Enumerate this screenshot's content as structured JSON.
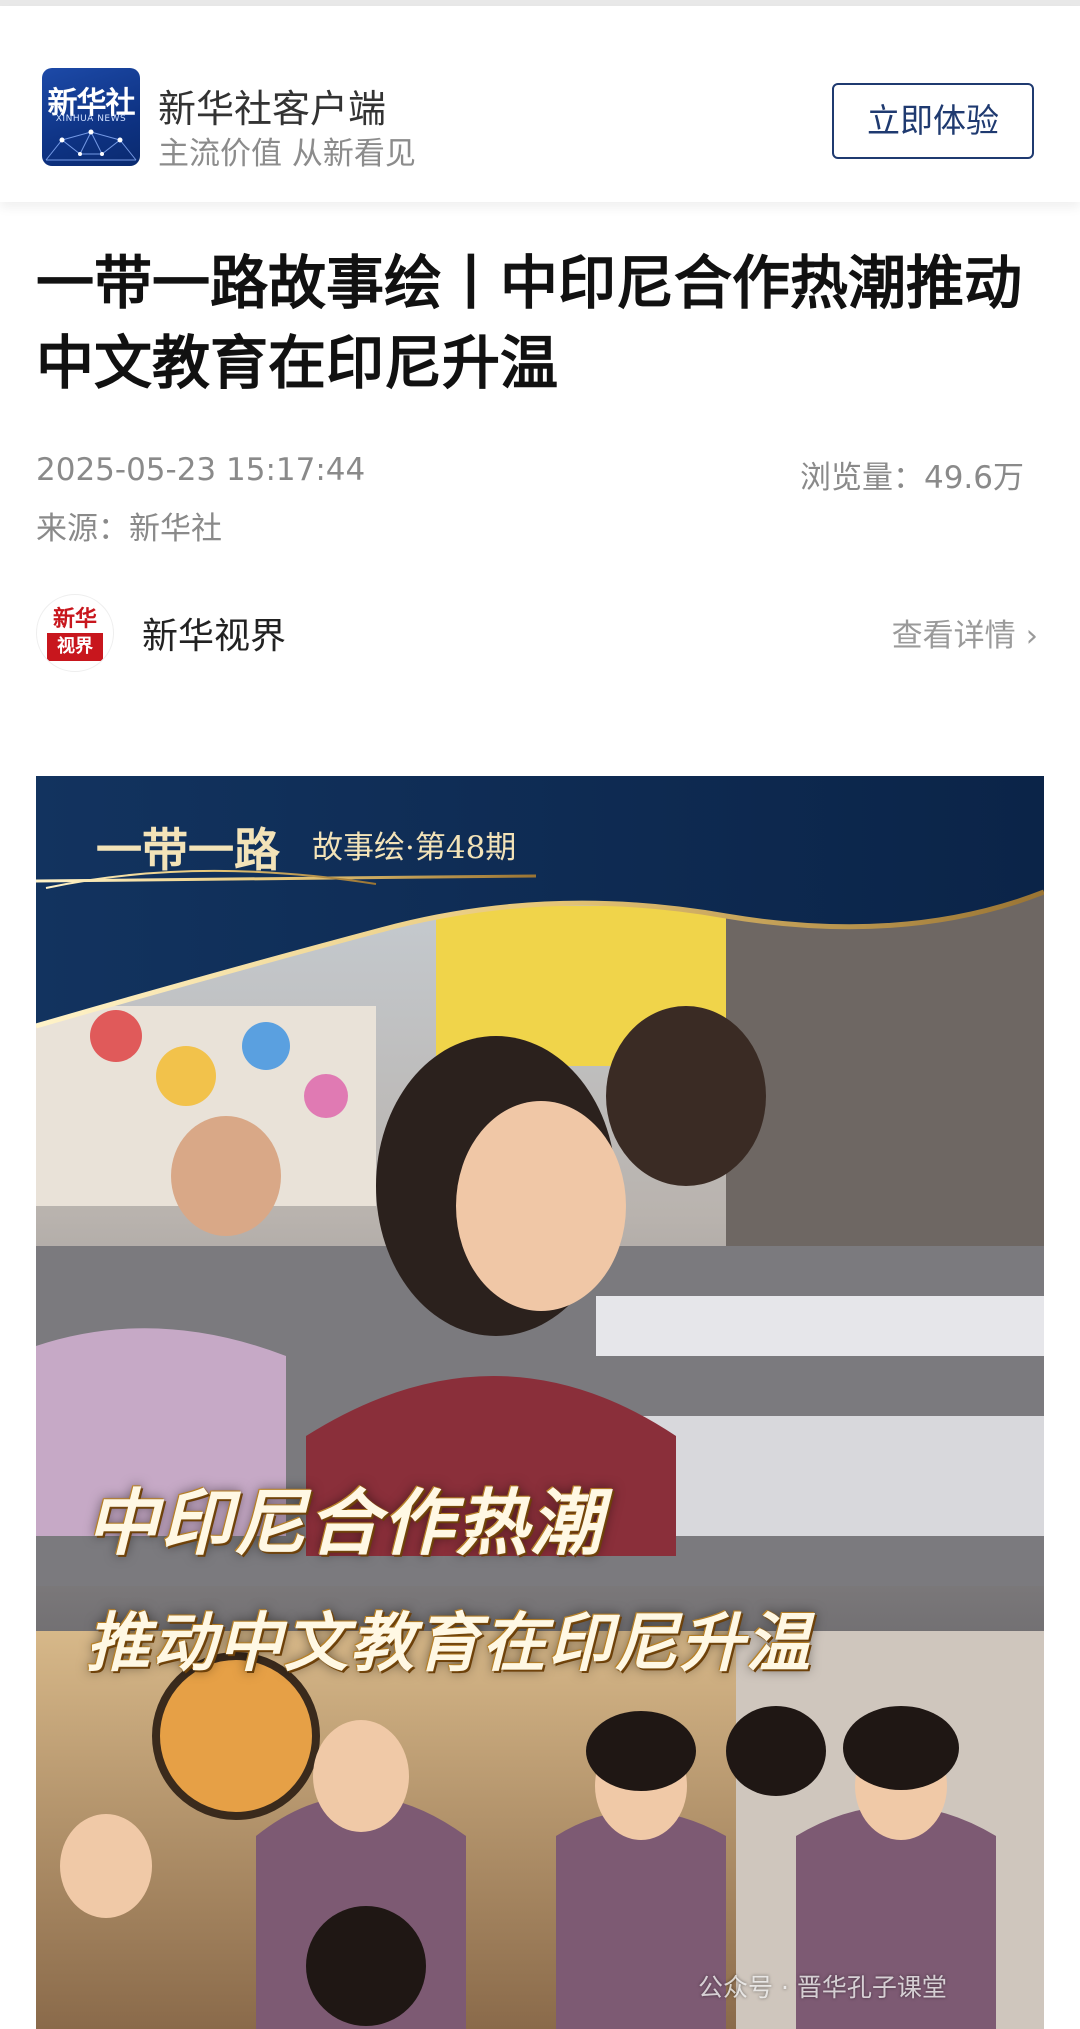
{
  "app_bar": {
    "logo_text": "新华社",
    "logo_subtext": "XINHUA NEWS",
    "app_name": "新华社客户端",
    "slogan": "主流价值 从新看见",
    "cta_label": "立即体验"
  },
  "article": {
    "title": "一带一路故事绘丨中印尼合作热潮推动中文教育在印尼升温",
    "datetime": "2025-05-23 15:17:44",
    "views": "浏览量：49.6万",
    "source": "来源：新华社"
  },
  "account": {
    "logo_top": "新华",
    "logo_bottom": "视界",
    "name": "新华视界",
    "detail_label": "查看详情"
  },
  "hero_image": {
    "banner_title": "一带一路",
    "banner_subtitle": "故事绘·第48期",
    "overlay_line1": "中印尼合作热潮",
    "overlay_line2": "推动中文教育在印尼升温",
    "watermark": "公众号 · 晋华孔子课堂"
  },
  "colors": {
    "cta_border": "#1f3a70",
    "banner_navy": "#0d2b57",
    "banner_gold": "#e7c778",
    "meta_gray": "#8a8a8a"
  },
  "icons": [
    "xinhua-logo-icon",
    "xinhua-vision-logo-icon",
    "chevron-right-icon"
  ]
}
